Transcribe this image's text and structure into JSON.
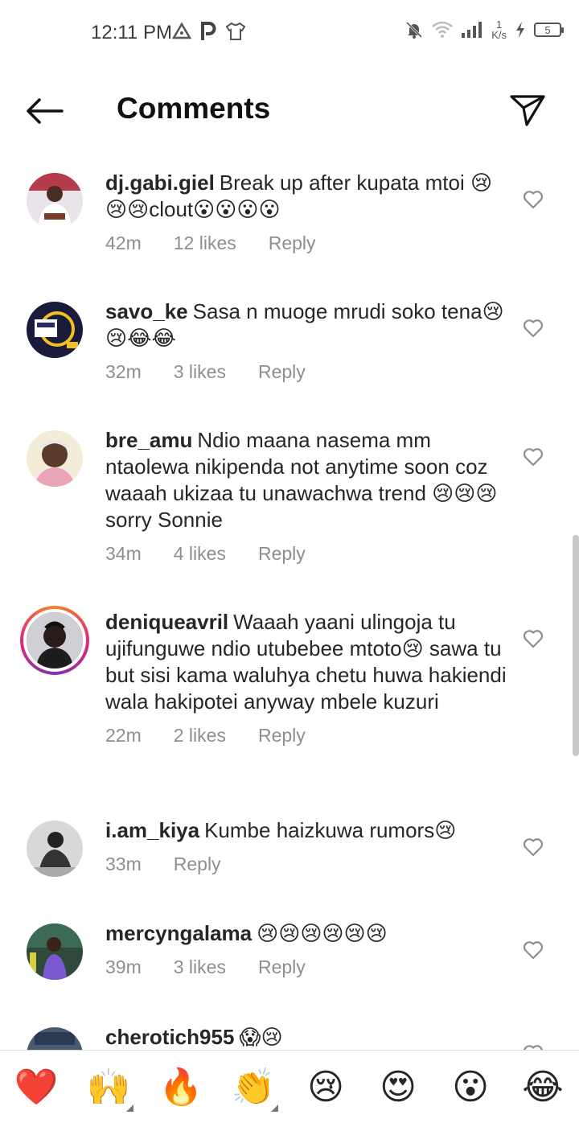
{
  "status_bar": {
    "time": "12:11 PM",
    "speed_value": "1",
    "speed_unit": "K/s",
    "battery": "5"
  },
  "header": {
    "title": "Comments"
  },
  "comments": [
    {
      "username": "dj.gabi.giel",
      "text": "Break up after kupata mtoi 😢😢😢clout😮😮😮😮",
      "time": "42m",
      "likes": "12 likes",
      "reply": "Reply"
    },
    {
      "username": "savo_ke",
      "text": "Sasa n muoge mrudi soko tena😢😢😂😂",
      "time": "32m",
      "likes": "3 likes",
      "reply": "Reply"
    },
    {
      "username": "bre_amu",
      "text": "Ndio maana nasema mm ntaolewa nikipenda not anytime soon coz waaah ukizaa tu unawachwa trend 😢😢😢sorry Sonnie",
      "time": "34m",
      "likes": "4 likes",
      "reply": "Reply"
    },
    {
      "username": "deniqueavril",
      "text": "Waaah yaani ulingoja tu ujifunguwe ndio utubebee mtoto😢 sawa tu but sisi kama waluhya chetu huwa hakiendi wala hakipotei anyway mbele kuzuri",
      "time": "22m",
      "likes": "2 likes",
      "reply": "Reply"
    },
    {
      "username": "i.am_kiya",
      "text": "Kumbe haizkuwa rumors😢",
      "time": "33m",
      "likes": "",
      "reply": "Reply"
    },
    {
      "username": "mercyngalama",
      "text": "😢😢😢😢😢😢",
      "time": "39m",
      "likes": "3 likes",
      "reply": "Reply"
    },
    {
      "username": "cherotich955",
      "text": "😱😢",
      "time": "",
      "likes": "",
      "reply": ""
    }
  ],
  "emoji_bar": [
    "❤️",
    "🙌",
    "🔥",
    "👏",
    "😢",
    "😍",
    "😮",
    "😂"
  ]
}
